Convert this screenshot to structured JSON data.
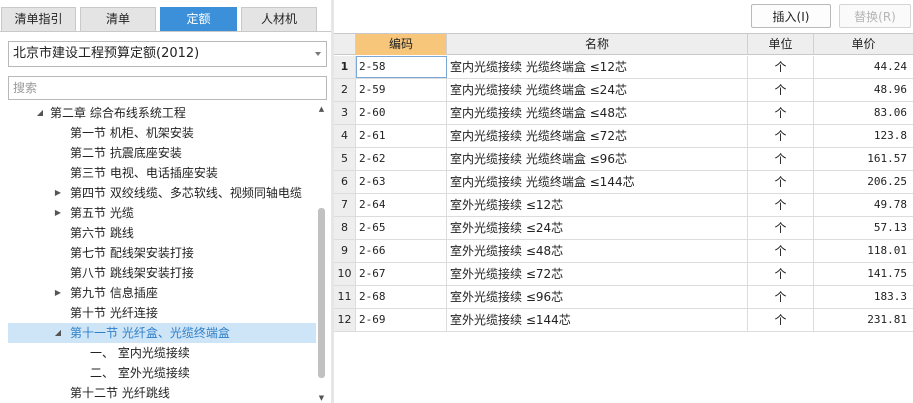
{
  "tabs": [
    {
      "label": "清单指引",
      "active": false
    },
    {
      "label": "清单",
      "active": false
    },
    {
      "label": "定额",
      "active": true
    },
    {
      "label": "人材机",
      "active": false
    }
  ],
  "library_select": {
    "value": "北京市建设工程预算定额(2012)"
  },
  "search": {
    "placeholder": "搜索",
    "value": ""
  },
  "tree": [
    {
      "label": "第二章 综合布线系统工程",
      "expander": "expanded"
    },
    {
      "label": "第一节 机柜、机架安装",
      "expander": "none"
    },
    {
      "label": "第二节 抗震底座安装",
      "expander": "none"
    },
    {
      "label": "第三节 电视、电话插座安装",
      "expander": "none"
    },
    {
      "label": "第四节 双绞线缆、多芯软线、视频同轴电缆",
      "expander": "collapsed"
    },
    {
      "label": "第五节 光缆",
      "expander": "collapsed"
    },
    {
      "label": "第六节 跳线",
      "expander": "none"
    },
    {
      "label": "第七节 配线架安装打接",
      "expander": "none"
    },
    {
      "label": "第八节 跳线架安装打接",
      "expander": "none"
    },
    {
      "label": "第九节 信息插座",
      "expander": "collapsed"
    },
    {
      "label": "第十节 光纤连接",
      "expander": "none"
    },
    {
      "label": "第十一节 光纤盒、光缆终端盒",
      "expander": "expanded",
      "selected": true
    },
    {
      "label": "一、 室内光缆接续",
      "expander": "none"
    },
    {
      "label": "二、 室外光缆接续",
      "expander": "none"
    },
    {
      "label": "第十二节 光纤跳线",
      "expander": "none"
    }
  ],
  "buttons": {
    "insert": "插入(I)",
    "replace": "替换(R)"
  },
  "table": {
    "headers": {
      "code": "编码",
      "name": "名称",
      "unit": "单位",
      "price": "单价"
    },
    "rows": [
      {
        "no": "1",
        "code": "2-58",
        "name": "室内光缆接续 光缆终端盒 ≤12芯",
        "unit": "个",
        "price": "44.24"
      },
      {
        "no": "2",
        "code": "2-59",
        "name": "室内光缆接续 光缆终端盒 ≤24芯",
        "unit": "个",
        "price": "48.96"
      },
      {
        "no": "3",
        "code": "2-60",
        "name": "室内光缆接续 光缆终端盒 ≤48芯",
        "unit": "个",
        "price": "83.06"
      },
      {
        "no": "4",
        "code": "2-61",
        "name": "室内光缆接续 光缆终端盒 ≤72芯",
        "unit": "个",
        "price": "123.8"
      },
      {
        "no": "5",
        "code": "2-62",
        "name": "室内光缆接续 光缆终端盒 ≤96芯",
        "unit": "个",
        "price": "161.57"
      },
      {
        "no": "6",
        "code": "2-63",
        "name": "室内光缆接续 光缆终端盒 ≤144芯",
        "unit": "个",
        "price": "206.25"
      },
      {
        "no": "7",
        "code": "2-64",
        "name": "室外光缆接续 ≤12芯",
        "unit": "个",
        "price": "49.78"
      },
      {
        "no": "8",
        "code": "2-65",
        "name": "室外光缆接续 ≤24芯",
        "unit": "个",
        "price": "57.13"
      },
      {
        "no": "9",
        "code": "2-66",
        "name": "室外光缆接续 ≤48芯",
        "unit": "个",
        "price": "118.01"
      },
      {
        "no": "10",
        "code": "2-67",
        "name": "室外光缆接续 ≤72芯",
        "unit": "个",
        "price": "141.75"
      },
      {
        "no": "11",
        "code": "2-68",
        "name": "室外光缆接续 ≤96芯",
        "unit": "个",
        "price": "183.3"
      },
      {
        "no": "12",
        "code": "2-69",
        "name": "室外光缆接续 ≤144芯",
        "unit": "个",
        "price": "231.81"
      }
    ]
  },
  "colors": {
    "accent": "#3c8fd9",
    "header_highlight": "#f7c67a",
    "selection": "#cde5f7"
  },
  "icons": {
    "dropdown": "chevron-down-icon",
    "expanded": "triangle-down-icon",
    "collapsed": "triangle-right-icon"
  }
}
